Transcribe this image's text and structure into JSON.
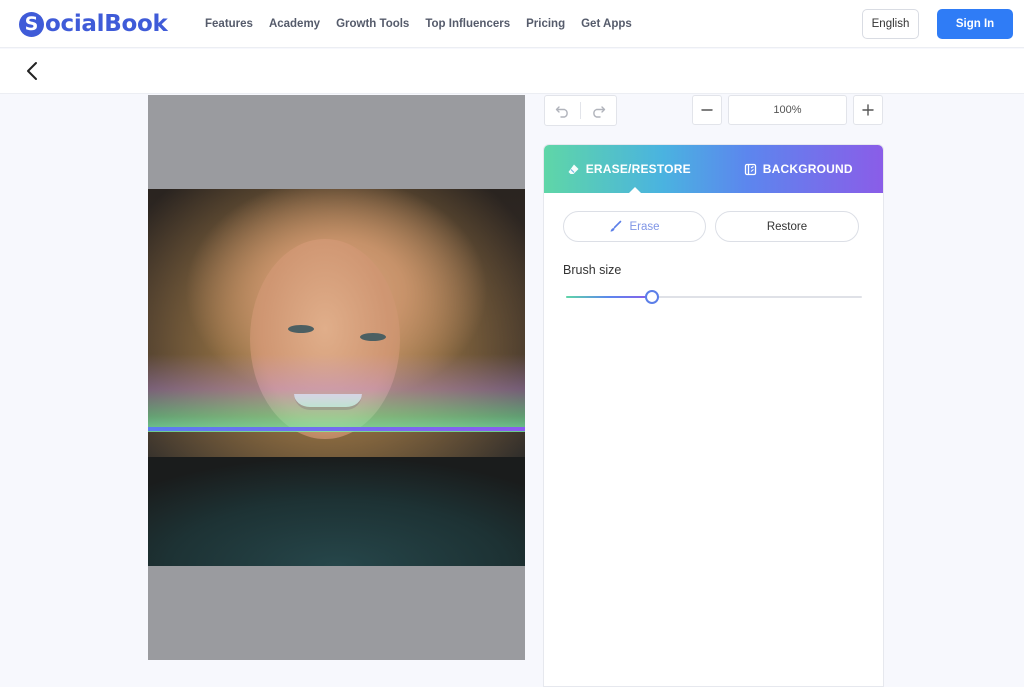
{
  "header": {
    "logo_mark": "S",
    "logo_text": "ocialBook",
    "nav": [
      {
        "label": "Features"
      },
      {
        "label": "Academy"
      },
      {
        "label": "Growth Tools"
      },
      {
        "label": "Top Influencers"
      },
      {
        "label": "Pricing"
      },
      {
        "label": "Get Apps"
      }
    ],
    "language": "English",
    "sign_in": "Sign In"
  },
  "subbar": {
    "back_icon": "chevron-left-icon"
  },
  "editor": {
    "undo_icon": "undo-icon",
    "redo_icon": "redo-icon",
    "zoom_out_icon": "minus-icon",
    "zoom_in_icon": "plus-icon",
    "zoom_value": "100%"
  },
  "panel": {
    "tabs": [
      {
        "label": "ERASE/RESTORE",
        "icon": "eraser-icon",
        "active": true
      },
      {
        "label": "BACKGROUND",
        "icon": "background-icon",
        "active": false
      }
    ],
    "erase_label": "Erase",
    "restore_label": "Restore",
    "brush_size_label": "Brush size",
    "brush_size_fraction": 0.29
  },
  "colors": {
    "brand": "#3f5bd8",
    "sign_in": "#2f7cf6",
    "tab_gradient_start": "#5fd6a7",
    "tab_gradient_end": "#8a5de8"
  }
}
